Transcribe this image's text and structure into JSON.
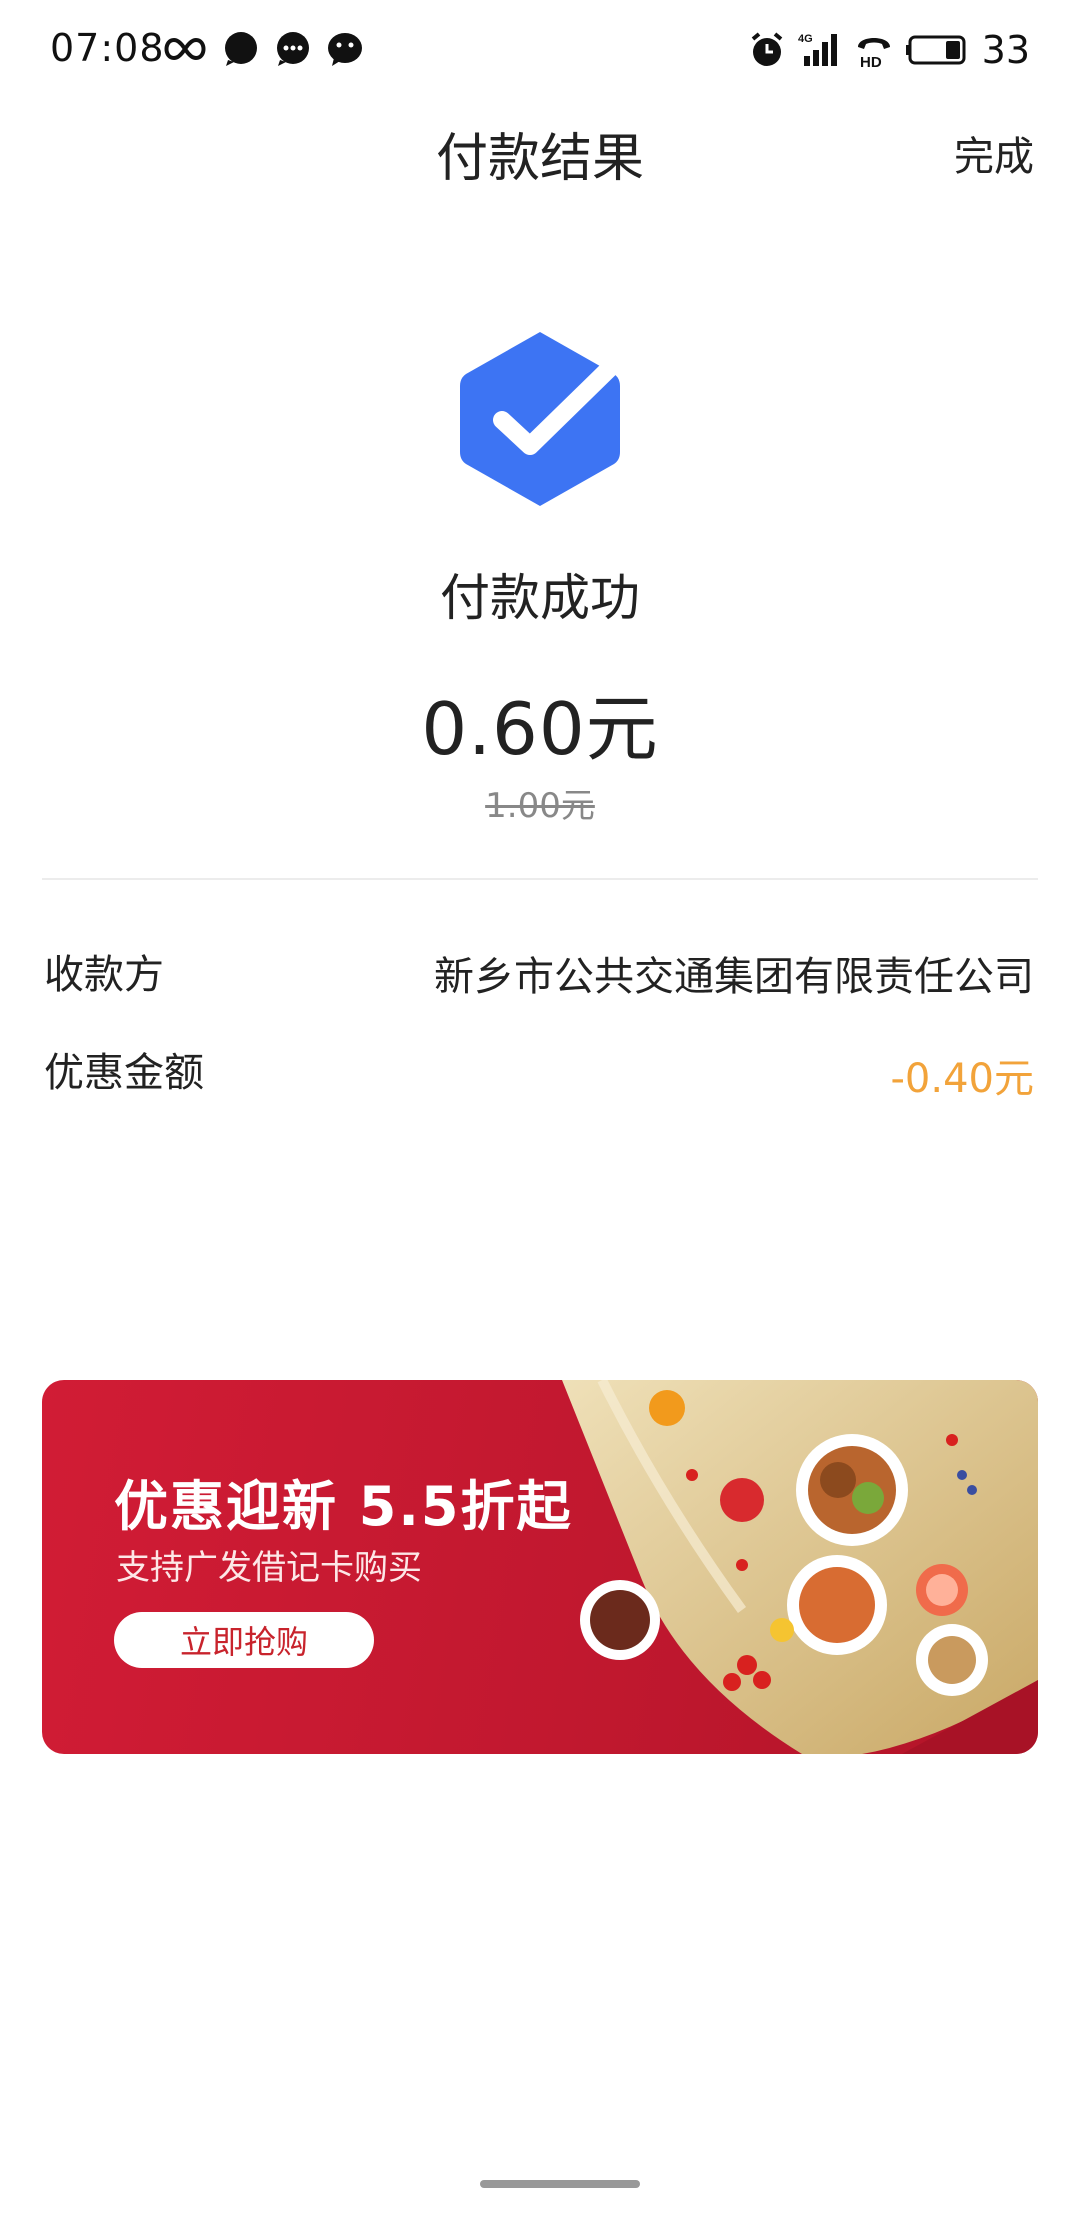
{
  "status_bar": {
    "time": "07:08",
    "battery_level": "33",
    "icons": [
      "infinity-icon",
      "chat-bubble-icon",
      "message-dots-icon",
      "wechat-icon",
      "alarm-icon",
      "signal-4g-icon",
      "hd-call-icon",
      "battery-icon"
    ]
  },
  "header": {
    "title": "付款结果",
    "done_label": "完成"
  },
  "result": {
    "status": "付款成功",
    "amount": "0.60元",
    "original_amount": "1.00元",
    "icon": "check-badge-icon"
  },
  "details": [
    {
      "label": "收款方",
      "value": "新乡市公共交通集团有限责任公司"
    },
    {
      "label": "优惠金额",
      "value": "-0.40元"
    }
  ],
  "banner": {
    "title": "优惠迎新  5.5折起",
    "subtitle": "支持广发借记卡购买",
    "button_label": "立即抢购"
  },
  "colors": {
    "accent_blue": "#3d74f3",
    "discount_orange": "#f2a33a",
    "banner_red": "#c1182f"
  }
}
